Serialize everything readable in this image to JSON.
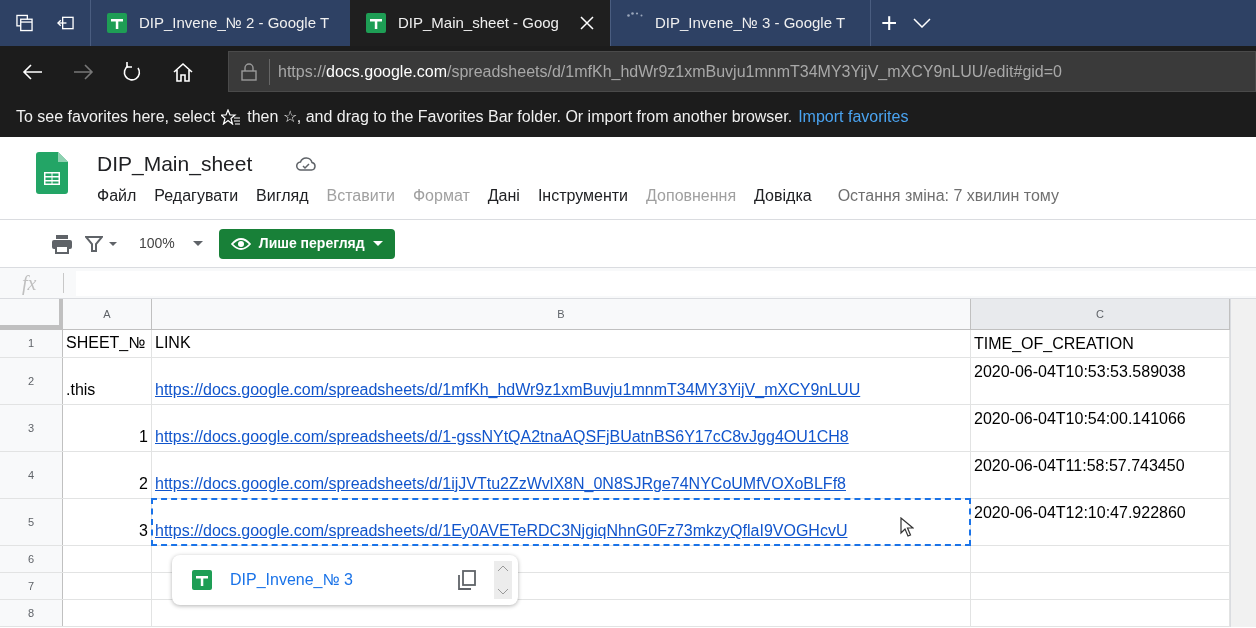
{
  "browser": {
    "tabs": [
      {
        "title": "DIP_Invene_№ 2 - Google T",
        "selected": false,
        "loading": false
      },
      {
        "title": "DIP_Main_sheet - Goog",
        "selected": true,
        "loading": false
      },
      {
        "title": "DIP_Invene_№ 3 - Google T",
        "selected": false,
        "loading": true
      }
    ],
    "new_tab": "+",
    "address": {
      "scheme": "https://",
      "host": "docs.google.com",
      "path": "/spreadsheets/d/1mfKh_hdWr9z1xmBuvju1mnmT34MY3YijV_mXCY9nLUU/edit#gid=0"
    },
    "favorites_bar": {
      "text_before": "To see favorites here, select",
      "text_after": "then ☆, and drag to the Favorites Bar folder. Or import from another browser.",
      "link": "Import favorites"
    }
  },
  "document": {
    "title": "DIP_Main_sheet",
    "menu": [
      {
        "label": "Файл",
        "disabled": false
      },
      {
        "label": "Редагувати",
        "disabled": false
      },
      {
        "label": "Вигляд",
        "disabled": false
      },
      {
        "label": "Вставити",
        "disabled": true
      },
      {
        "label": "Формат",
        "disabled": true
      },
      {
        "label": "Дані",
        "disabled": false
      },
      {
        "label": "Інструменти",
        "disabled": false
      },
      {
        "label": "Доповнення",
        "disabled": true
      },
      {
        "label": "Довідка",
        "disabled": false
      }
    ],
    "last_edit": "Остання зміна: 7 хвилин тому"
  },
  "toolbar": {
    "zoom": "100%",
    "mode_button": "Лише перегляд"
  },
  "formula_bar": {
    "label": "fx"
  },
  "sheet": {
    "columns": [
      "A",
      "B",
      "C"
    ],
    "rows": [
      {
        "number": "1",
        "cells": [
          {
            "text": "SHEET_№",
            "kind": "text",
            "selected": false
          },
          {
            "text": "LINK",
            "kind": "text",
            "selected": false
          },
          {
            "text": "TIME_OF_CREATION",
            "kind": "text",
            "selected": false
          }
        ]
      },
      {
        "number": "2",
        "cells": [
          {
            "text": ".this",
            "kind": "text",
            "selected": false
          },
          {
            "text": "https://docs.google.com/spreadsheets/d/1mfKh_hdWr9z1xmBuvju1mnmT34MY3YijV_mXCY9nLUU",
            "kind": "link",
            "selected": false
          },
          {
            "text": "2020-06-04T10:53:53.589038",
            "kind": "text",
            "selected": false
          }
        ]
      },
      {
        "number": "3",
        "cells": [
          {
            "text": "1",
            "kind": "number",
            "selected": false
          },
          {
            "text": "https://docs.google.com/spreadsheets/d/1-gssNYtQA2tnaAQSFjBUatnBS6Y17cC8vJgg4OU1CH8",
            "kind": "link",
            "selected": false
          },
          {
            "text": "2020-06-04T10:54:00.141066",
            "kind": "text",
            "selected": false
          }
        ]
      },
      {
        "number": "4",
        "cells": [
          {
            "text": "2",
            "kind": "number",
            "selected": false
          },
          {
            "text": "https://docs.google.com/spreadsheets/d/1ijJVTtu2ZzWvlX8N_0N8SJRge74NYCoUMfVOXoBLFf8",
            "kind": "link",
            "selected": false
          },
          {
            "text": "2020-06-04T11:58:57.743450",
            "kind": "text",
            "selected": false
          }
        ]
      },
      {
        "number": "5",
        "cells": [
          {
            "text": "3",
            "kind": "number",
            "selected": false
          },
          {
            "text": "https://docs.google.com/spreadsheets/d/1Ey0AVETeRDC3NjgiqNhnG0Fz73mkzyQflaI9VOGHcvU",
            "kind": "link",
            "selected": true
          },
          {
            "text": "2020-06-04T12:10:47.922860",
            "kind": "text",
            "selected": false
          }
        ]
      },
      {
        "number": "6"
      },
      {
        "number": "7"
      },
      {
        "number": "8"
      }
    ]
  },
  "link_popup": {
    "title": "DIP_Invene_№ 3"
  }
}
